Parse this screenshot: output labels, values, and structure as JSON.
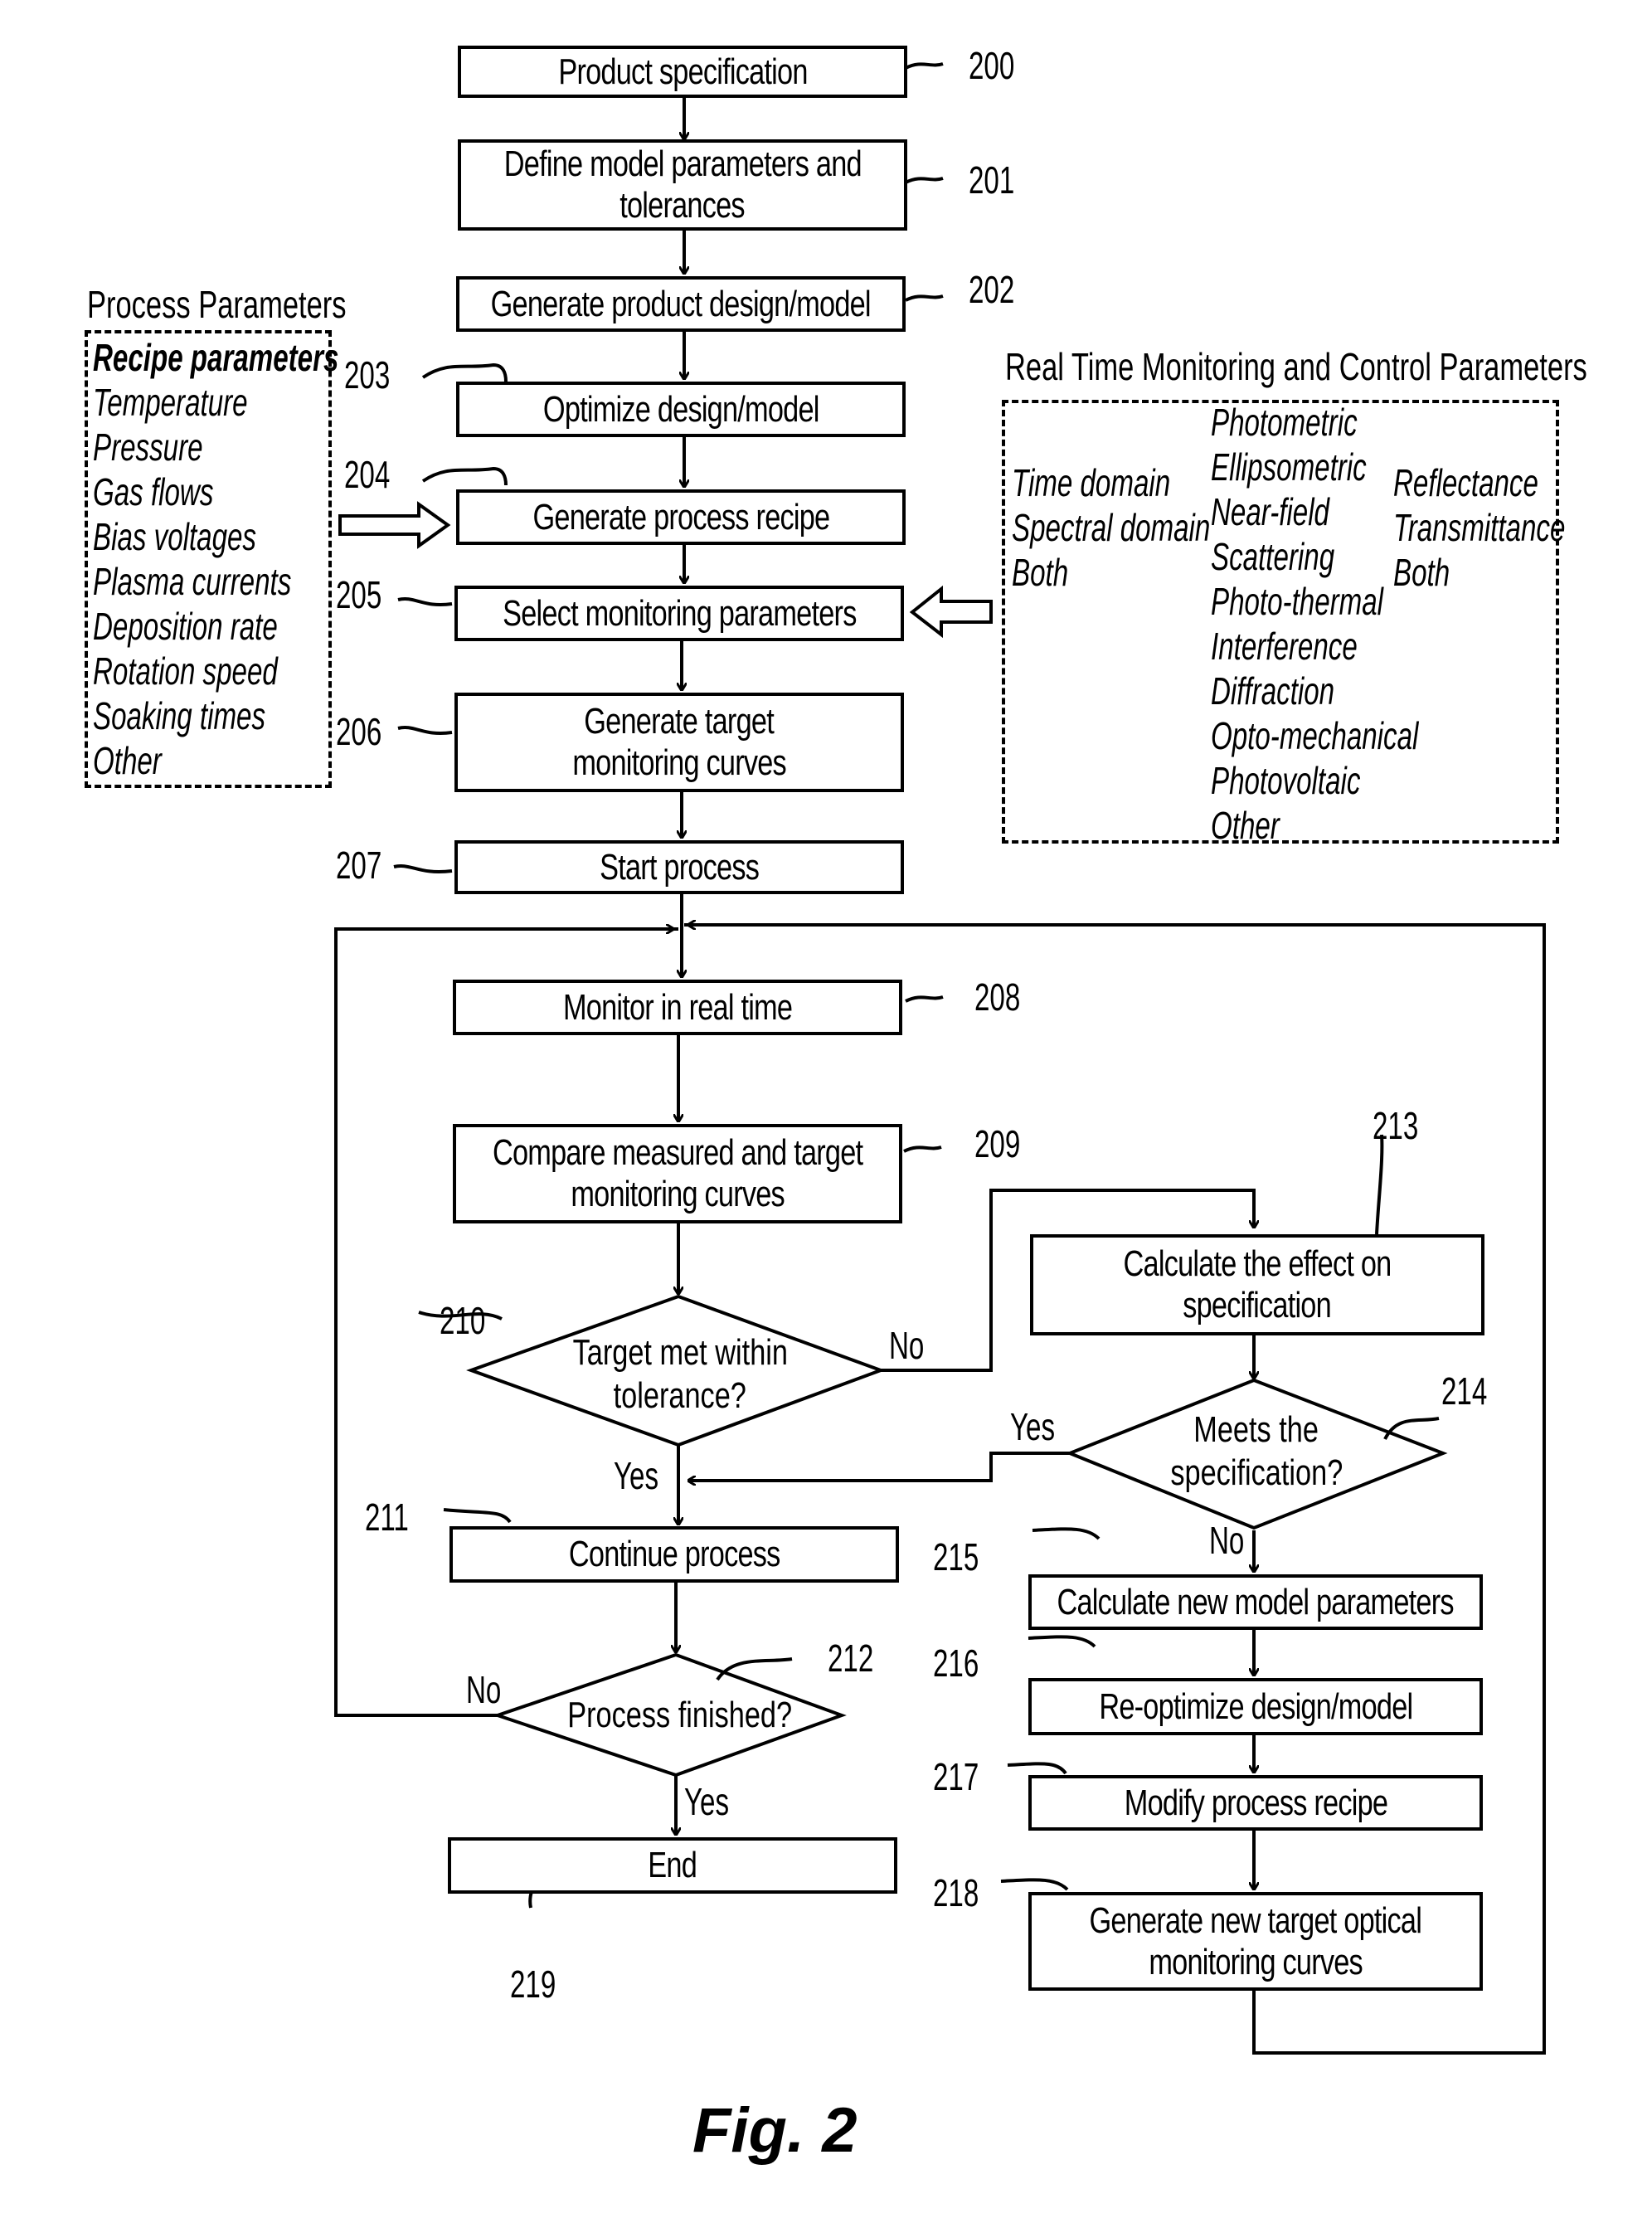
{
  "figure": {
    "caption": "Fig. 2"
  },
  "steps": {
    "s200": {
      "label": "Product specification",
      "ref": "200"
    },
    "s201": {
      "line1": "Define model parameters and",
      "line2": "tolerances",
      "ref": "201"
    },
    "s202": {
      "label": "Generate product design/model",
      "ref": "202"
    },
    "s203": {
      "label": "Optimize design/model",
      "ref": "203"
    },
    "s204": {
      "label": "Generate process recipe",
      "ref": "204"
    },
    "s205": {
      "label": "Select monitoring parameters",
      "ref": "205"
    },
    "s206": {
      "line1": "Generate target",
      "line2": "monitoring curves",
      "ref": "206"
    },
    "s207": {
      "label": "Start process",
      "ref": "207"
    },
    "s208": {
      "label": "Monitor in real time",
      "ref": "208"
    },
    "s209": {
      "line1": "Compare measured and target",
      "line2": "monitoring curves",
      "ref": "209"
    },
    "s210": {
      "line1": "Target met within",
      "line2": "tolerance?",
      "ref": "210",
      "yes": "Yes",
      "no": "No"
    },
    "s211": {
      "label": "Continue process",
      "ref": "211"
    },
    "s212": {
      "label": "Process finished?",
      "ref": "212",
      "yes": "Yes",
      "no": "No"
    },
    "s213": {
      "line1": "Calculate the effect on",
      "line2": "specification",
      "ref": "213"
    },
    "s214": {
      "line1": "Meets the",
      "line2": "specification?",
      "ref": "214",
      "yes": "Yes",
      "no": "No"
    },
    "s215": {
      "label": "Calculate new model parameters",
      "ref": "215"
    },
    "s216": {
      "label": "Re-optimize design/model",
      "ref": "216"
    },
    "s217": {
      "label": "Modify process recipe",
      "ref": "217"
    },
    "s218": {
      "line1": "Generate new target optical",
      "line2": "monitoring curves",
      "ref": "218"
    },
    "s219": {
      "label": "End",
      "ref": "219"
    }
  },
  "process_parameters": {
    "title": "Process Parameters",
    "items": [
      "Recipe parameters",
      "Temperature",
      "Pressure",
      "Gas flows",
      "Bias voltages",
      "Plasma currents",
      "Deposition rate",
      "Rotation speed",
      "Soaking times",
      "Other"
    ]
  },
  "monitoring_parameters": {
    "title": "Real Time Monitoring and Control Parameters",
    "domain": [
      "Time domain",
      "Spectral domain",
      "Both"
    ],
    "methods": [
      "Photometric",
      "Ellipsometric",
      "Near-field",
      "Scattering",
      "Photo-thermal",
      "Interference",
      "Diffraction",
      "Opto-mechanical",
      "Photovoltaic",
      "Other"
    ],
    "mode": [
      "Reflectance",
      "Transmittance",
      "Both"
    ]
  }
}
